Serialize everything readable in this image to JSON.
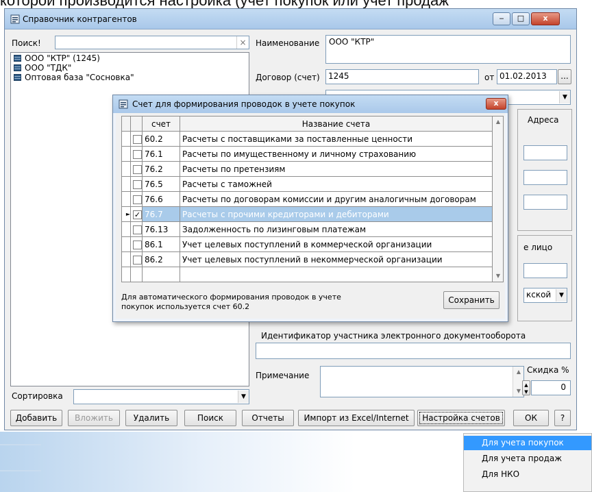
{
  "background_text": "которой производится настройка (учет покупок или учет продаж",
  "window": {
    "title": "Справочник контрагентов",
    "buttons": {
      "minimize": "‒",
      "maximize": "□",
      "close": "x"
    }
  },
  "left_panel": {
    "search_label": "Поиск!",
    "search_value": "",
    "search_clear": "×",
    "items": [
      "ООО \"КТР\" (1245)",
      "ООО \"ТДК\"",
      "Оптовая база \"Сосновка\""
    ],
    "sort_label": "Сортировка",
    "sort_value": ""
  },
  "right_panel": {
    "name_label": "Наименование",
    "name_value": "ООО \"КТР\"",
    "contract_label": "Договор (счет)",
    "contract_value": "1245",
    "date_label": "от",
    "date_value": "01.02.2013",
    "date_button": "...",
    "addresses_label": "Адреса",
    "contact_label": "е лицо",
    "type_value": "кской",
    "edo_label": "Идентификатор участника электронного документооборота",
    "edo_value": "",
    "note_label": "Примечание",
    "note_value": "",
    "discount_label": "Скидка %",
    "discount_value": "0"
  },
  "toolbar": {
    "add": "Добавить",
    "insert": "Вложить",
    "delete": "Удалить",
    "search": "Поиск",
    "reports": "Отчеты",
    "import": "Импорт из Excel/Internet",
    "accounts": "Настройка счетов",
    "ok": "ОК",
    "help": "?"
  },
  "dialog": {
    "title": "Счет для формирования проводок в учете покупок",
    "close": "x",
    "columns": {
      "account": "счет",
      "name": "Название счета"
    },
    "rows": [
      {
        "account": "60.2",
        "name": "Расчеты с поставщиками за поставленные ценности",
        "checked": false
      },
      {
        "account": "76.1",
        "name": "Расчеты по имущественному и личному страхованию",
        "checked": false
      },
      {
        "account": "76.2",
        "name": "Расчеты по претензиям",
        "checked": false
      },
      {
        "account": "76.5",
        "name": "Расчеты с таможней",
        "checked": false
      },
      {
        "account": "76.6",
        "name": "Расчеты по договорам комиссии и другим аналогичным договорам",
        "checked": false
      },
      {
        "account": "76.7",
        "name": "Расчеты с прочими кредиторами и дебиторами",
        "checked": true,
        "selected": true
      },
      {
        "account": "76.13",
        "name": "Задолженность по лизинговым платежам",
        "checked": false
      },
      {
        "account": "86.1",
        "name": "Учет целевых поступлений в коммерческой организации",
        "checked": false
      },
      {
        "account": "86.2",
        "name": "Учет целевых поступлений в некоммерческой организации",
        "checked": false
      }
    ],
    "row_pointer": "►",
    "check_mark": "✓",
    "info_line1": "Для автоматического формирования проводок в учете",
    "info_line2": "покупок используется счет 60.2",
    "save": "Сохранить"
  },
  "context_menu": {
    "items": [
      "Для учета покупок",
      "Для учета продаж",
      "Для НКО"
    ],
    "highlighted": 0
  },
  "colors": {
    "titlebar": "#b8d4f0",
    "selection_row": "#a9cbea",
    "menu_highlight": "#3399ff"
  }
}
